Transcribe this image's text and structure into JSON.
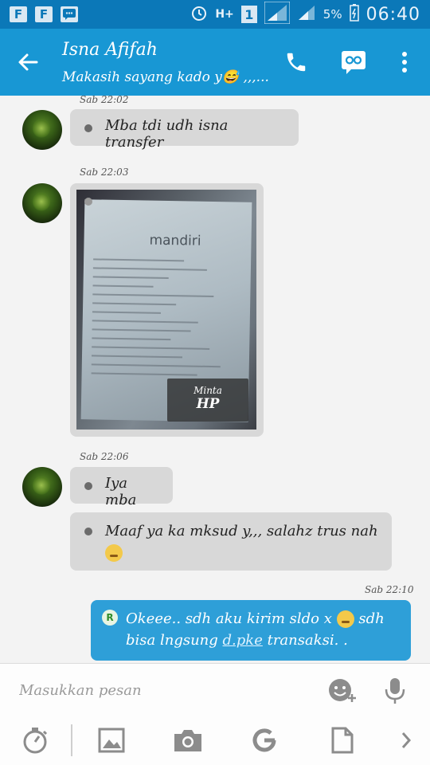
{
  "status_bar": {
    "left_icons": [
      "F",
      "F"
    ],
    "network": "H+",
    "sim": "1",
    "battery": "5%",
    "time": "06:40"
  },
  "header": {
    "title": "Isna Afifah",
    "subtitle": "Makasih sayang kado y😅 ,,,...",
    "back_icon": "arrow-left-icon",
    "actions": [
      "phone-icon",
      "video-chat-icon",
      "more-vertical-icon"
    ]
  },
  "messages": [
    {
      "timestamp": "Sab 22:02",
      "text": "Mba tdi udh isna transfer"
    },
    {
      "timestamp": "Sab 22:03",
      "type": "image",
      "receipt_brand": "mandiri",
      "overlay_line1": "Minta",
      "overlay_line2": "HP"
    },
    {
      "timestamp": "Sab 22:06",
      "text": "Iya mba"
    },
    {
      "text": "Maaf ya ka mksud y,,, salahz trus nah"
    },
    {
      "timestamp": "Sab 22:10",
      "sender_badge": "R",
      "text_part1": "Okeee.. sdh aku kirim sldo x",
      "text_part2": "sdh bisa lngsung",
      "link": "d.pke",
      "text_part3": "transaksi. ."
    }
  ],
  "composer": {
    "placeholder": "Masukkan pesan",
    "tools": [
      "timer-icon",
      "image-icon",
      "camera-icon",
      "refresh-g-icon",
      "file-icon",
      "chevron-right-icon"
    ]
  },
  "colors": {
    "status_bar": "#0b78b8",
    "app_bar": "#1897d4",
    "incoming_bubble": "#d8d8d8",
    "outgoing_bubble": "#2e9fd8"
  }
}
